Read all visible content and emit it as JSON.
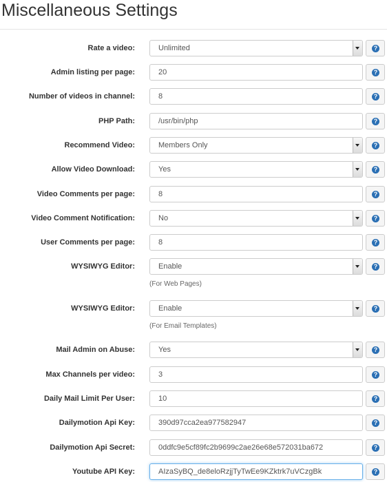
{
  "page_title": "Miscellaneous Settings",
  "help_glyph": "?",
  "rows": [
    {
      "label": "Rate a video:",
      "value": "Unlimited",
      "type": "select"
    },
    {
      "label": "Admin listing per page:",
      "value": "20",
      "type": "text"
    },
    {
      "label": "Number of videos in channel:",
      "value": "8",
      "type": "text"
    },
    {
      "label": "PHP Path:",
      "value": "/usr/bin/php",
      "type": "text"
    },
    {
      "label": "Recommend Video:",
      "value": "Members Only",
      "type": "select"
    },
    {
      "label": "Allow Video Download:",
      "value": "Yes",
      "type": "select"
    },
    {
      "label": "Video Comments per page:",
      "value": "8",
      "type": "text"
    },
    {
      "label": "Video Comment Notification:",
      "value": "No",
      "type": "select"
    },
    {
      "label": "User Comments per page:",
      "value": "8",
      "type": "text"
    },
    {
      "label": "WYSIWYG Editor:",
      "value": "Enable",
      "type": "select",
      "hint": "(For Web Pages)"
    },
    {
      "label": "WYSIWYG Editor:",
      "value": "Enable",
      "type": "select",
      "hint": "(For Email Templates)"
    },
    {
      "label": "Mail Admin on Abuse:",
      "value": "Yes",
      "type": "select"
    },
    {
      "label": "Max Channels per video:",
      "value": "3",
      "type": "text"
    },
    {
      "label": "Daily Mail Limit Per User:",
      "value": "10",
      "type": "text"
    },
    {
      "label": "Dailymotion Api Key:",
      "value": "390d97cca2ea977582947",
      "type": "text"
    },
    {
      "label": "Dailymotion Api Secret:",
      "value": "0ddfc9e5cf89fc2b9699c2ae26e68e572031ba672",
      "type": "text"
    },
    {
      "label": "Youtube API Key:",
      "value": "AIzaSyBQ_de8eloRzjjTyTwEe9KZktrk7uVCzgBk",
      "type": "text",
      "focused": true
    }
  ]
}
